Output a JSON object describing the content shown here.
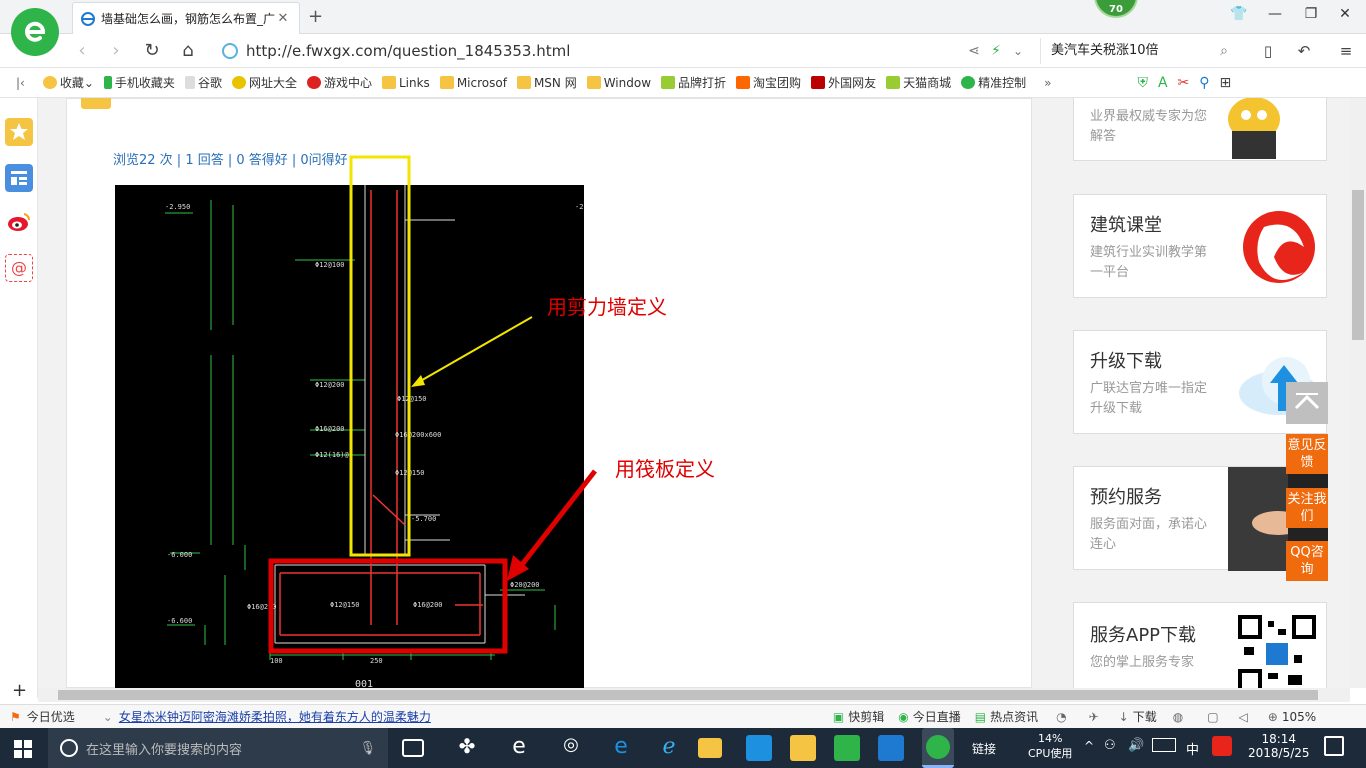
{
  "tab": {
    "title": "墙基础怎么画，钢筋怎么布置_广"
  },
  "badge": {
    "value": "70"
  },
  "address": {
    "url": "http://e.fwxgx.com/question_1845353.html"
  },
  "search": {
    "text": "美汽车关税涨10倍"
  },
  "bookmarks": [
    "收藏",
    "手机收藏夹",
    "谷歌",
    "网址大全",
    "游戏中心",
    "Links",
    "Microsof",
    "MSN 网",
    "Window",
    "品牌打折",
    "淘宝团购",
    "外国网友",
    "天猫商城",
    "精准控制"
  ],
  "page": {
    "stats": "浏览22 次 | 1 回答 | 0 答得好 | 0问得好",
    "annotation_wall": "用剪力墙定义",
    "annotation_raft": "用筏板定义"
  },
  "sidebar_cards": [
    {
      "title": "",
      "desc": "业界最权威专家为您解答"
    },
    {
      "title": "建筑课堂",
      "desc": "建筑行业实训教学第一平台"
    },
    {
      "title": "升级下载",
      "desc": "广联达官方唯一指定升级下载"
    },
    {
      "title": "预约服务",
      "desc": "服务面对面，承诺心连心"
    },
    {
      "title": "服务APP下载",
      "desc": "您的掌上服务专家"
    }
  ],
  "float_buttons": [
    "意见反馈",
    "关注我们",
    "QQ咨询"
  ],
  "statusbar": {
    "today": "今日优选",
    "news": "女星杰米钟迈阿密海滩娇柔拍照，她有着东方人的温柔魅力",
    "items": [
      "快剪辑",
      "今日直播",
      "热点资讯",
      "下载"
    ],
    "zoom": "105%"
  },
  "taskbar": {
    "search_placeholder": "在这里输入你要搜索的内容",
    "link_label": "链接",
    "cpu_value": "14%",
    "cpu_label": "CPU使用",
    "ime": "中",
    "time": "18:14",
    "date": "2018/5/25"
  },
  "colors": {
    "accent_green": "#2fb44a",
    "link_blue": "#2a6fb8",
    "annotation_red": "#e00000",
    "annotation_yellow": "#f2e600",
    "float_orange": "#f06a0e"
  }
}
